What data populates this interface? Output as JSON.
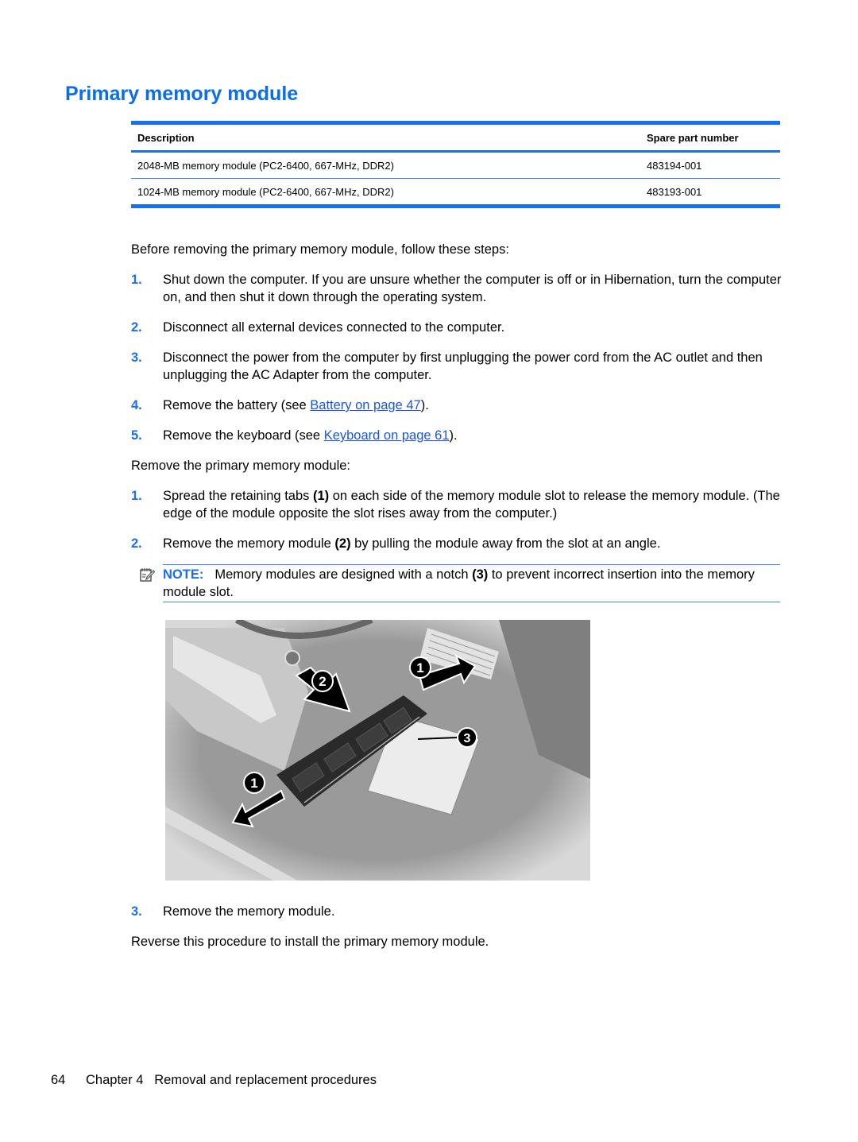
{
  "heading": "Primary memory module",
  "table": {
    "headers": [
      "Description",
      "Spare part number"
    ],
    "rows": [
      [
        "2048-MB memory module (PC2-6400, 667-MHz, DDR2)",
        "483194-001"
      ],
      [
        "1024-MB memory module (PC2-6400, 667-MHz, DDR2)",
        "483193-001"
      ]
    ]
  },
  "intro": "Before removing the primary memory module, follow these steps:",
  "prep_steps": [
    {
      "num": "1.",
      "text": "Shut down the computer. If you are unsure whether the computer is off or in Hibernation, turn the computer on, and then shut it down through the operating system."
    },
    {
      "num": "2.",
      "text": "Disconnect all external devices connected to the computer."
    },
    {
      "num": "3.",
      "text": "Disconnect the power from the computer by first unplugging the power cord from the AC outlet and then unplugging the AC Adapter from the computer."
    },
    {
      "num": "4.",
      "pre": "Remove the battery (see ",
      "link": "Battery on page 47",
      "post": ")."
    },
    {
      "num": "5.",
      "pre": "Remove the keyboard (see ",
      "link": "Keyboard on page 61",
      "post": ")."
    }
  ],
  "remove_intro": "Remove the primary memory module:",
  "remove_steps": [
    {
      "num": "1.",
      "pre": "Spread the retaining tabs ",
      "bold": "(1)",
      "post": " on each side of the memory module slot to release the memory module. (The edge of the module opposite the slot rises away from the computer.)"
    },
    {
      "num": "2.",
      "pre": "Remove the memory module ",
      "bold": "(2)",
      "post": " by pulling the module away from the slot at an angle."
    },
    {
      "num": "3.",
      "text": "Remove the memory module."
    }
  ],
  "note": {
    "label": "NOTE:",
    "pre": "Memory modules are designed with a notch ",
    "bold": "(3)",
    "post": " to prevent incorrect insertion into the memory module slot.",
    "icon": "note-pencil-icon"
  },
  "figure": {
    "callouts": [
      "1",
      "2",
      "1",
      "3"
    ],
    "description": "Memory module removal illustration"
  },
  "closing": "Reverse this procedure to install the primary memory module.",
  "footer": {
    "page_number": "64",
    "chapter": "Chapter 4",
    "chapter_title": "Removal and replacement procedures"
  },
  "colors": {
    "accent": "#1a6ef0",
    "heading": "#0a6ee8",
    "link": "#1a55e0"
  }
}
